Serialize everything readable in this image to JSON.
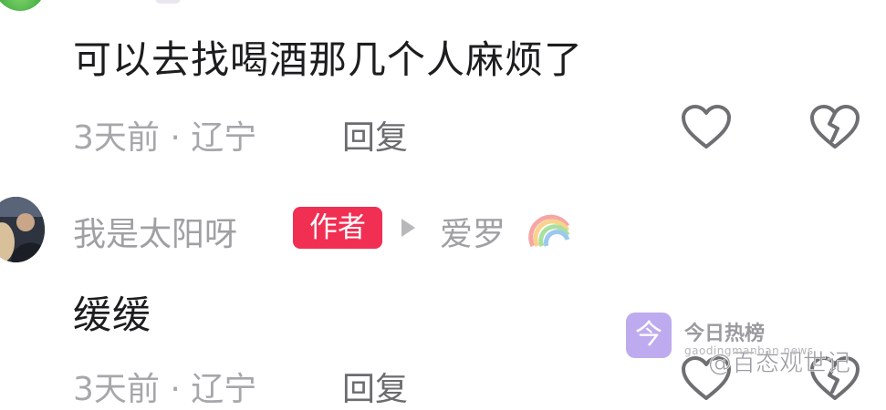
{
  "comments": [
    {
      "text": "可以去找喝酒那几个人麻烦了",
      "meta": "3天前 · 辽宁",
      "reply_label": "回复",
      "like_icon": "heart-outline-icon",
      "dislike_icon": "broken-heart-icon"
    },
    {
      "username": "我是太阳呀",
      "author_badge": "作者",
      "reply_to": "爱罗",
      "reply_to_icon": "rainbow-icon",
      "text": "缓缓",
      "meta": "3天前 · 辽宁",
      "reply_label": "回复",
      "like_icon": "heart-outline-icon",
      "dislike_icon": "broken-heart-icon"
    }
  ],
  "watermark": {
    "logo_glyph": "今",
    "name": "今日热榜",
    "url": "gaodingmanban.news",
    "handle": "@百态观世记"
  },
  "colors": {
    "text_primary": "#1d1d1f",
    "text_meta": "#a7a7ab",
    "author_badge_bg": "#f12f53",
    "watermark_logo_bg": "#b8a3ee"
  }
}
